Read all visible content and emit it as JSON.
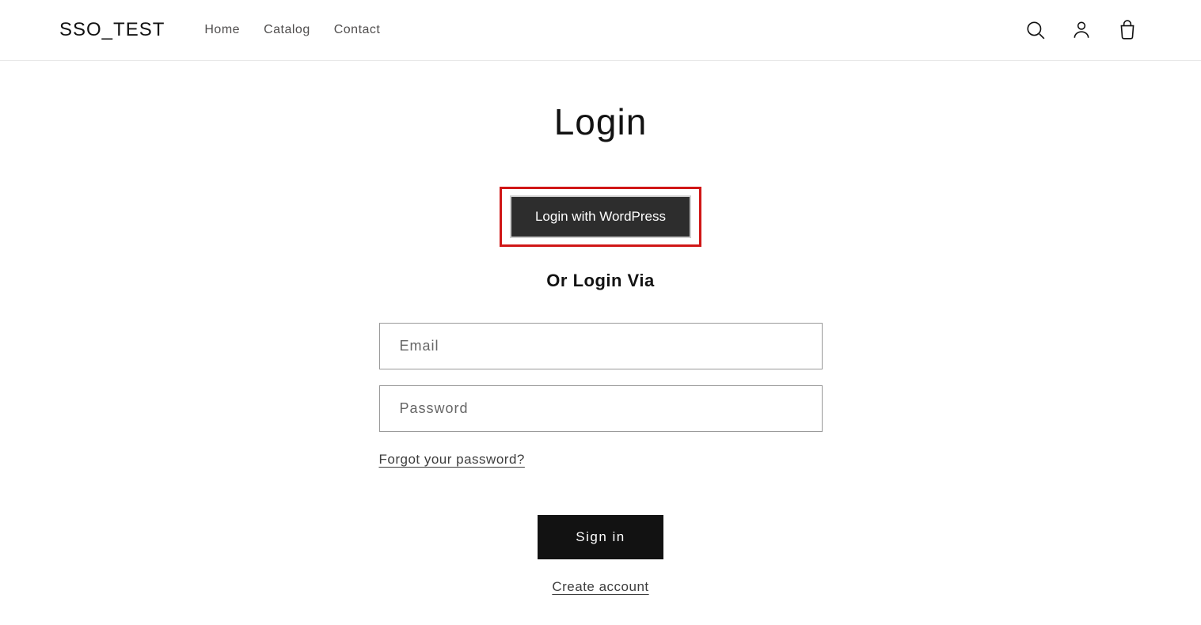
{
  "header": {
    "brand": "SSO_TEST",
    "nav": {
      "home": "Home",
      "catalog": "Catalog",
      "contact": "Contact"
    }
  },
  "login": {
    "title": "Login",
    "sso_button": "Login with WordPress",
    "divider": "Or Login Via",
    "email_placeholder": "Email",
    "password_placeholder": "Password",
    "forgot_link": "Forgot your password?",
    "signin_button": "Sign in",
    "create_link": "Create account"
  }
}
